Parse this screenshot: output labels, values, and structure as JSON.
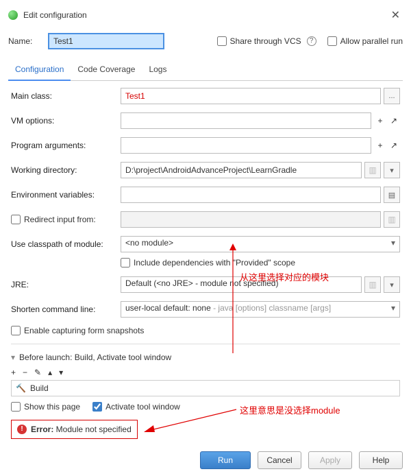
{
  "window": {
    "title": "Edit configuration"
  },
  "name": {
    "label": "Name:",
    "value": "Test1"
  },
  "shareVcs": {
    "label": "Share through VCS",
    "checked": false
  },
  "allowParallel": {
    "label": "Allow parallel run",
    "checked": false
  },
  "tabs": {
    "configuration": "Configuration",
    "codeCoverage": "Code Coverage",
    "logs": "Logs"
  },
  "form": {
    "mainClass": {
      "label": "Main class:",
      "value": "Test1"
    },
    "vmOptions": {
      "label": "VM options:",
      "value": ""
    },
    "programArgs": {
      "label": "Program arguments:",
      "value": ""
    },
    "workingDir": {
      "label": "Working directory:",
      "value": "D:\\project\\AndroidAdvanceProject\\LearnGradle"
    },
    "envVars": {
      "label": "Environment variables:",
      "value": ""
    },
    "redirect": {
      "label": "Redirect input from:",
      "value": ""
    },
    "classpath": {
      "label": "Use classpath of module:",
      "value": "<no module>"
    },
    "includeDeps": {
      "label": "Include dependencies with \"Provided\" scope"
    },
    "jre": {
      "label": "JRE:",
      "default": "Default",
      "hint": "(<no JRE> - module not specified)"
    },
    "shorten": {
      "label": "Shorten command line:",
      "value": "user-local default: none",
      "hint": " - java [options] classname [args]"
    },
    "capture": {
      "label": "Enable capturing form snapshots"
    }
  },
  "beforeLaunch": {
    "header": "Before launch: Build, Activate tool window",
    "buildItem": "Build",
    "showPage": "Show this page",
    "activateWindow": "Activate tool window"
  },
  "error": {
    "prefix": "Error:",
    "msg": " Module not specified"
  },
  "buttons": {
    "run": "Run",
    "cancel": "Cancel",
    "apply": "Apply",
    "help": "Help"
  },
  "annotations": {
    "top": "从这里选择对应的模块",
    "right": "这里意思是没选择module"
  }
}
